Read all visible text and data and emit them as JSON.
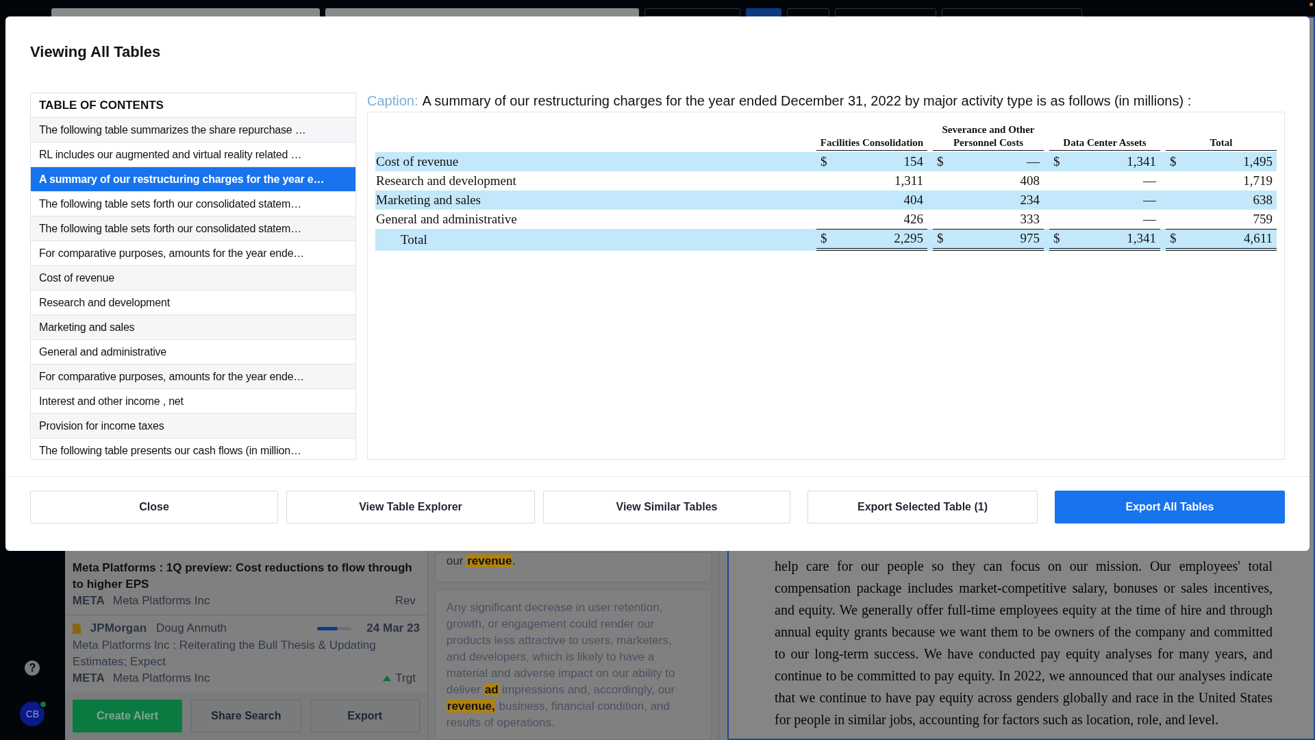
{
  "background": {
    "sidebar": {
      "help": "?",
      "avatar": {
        "initials": "CB",
        "online": true
      }
    },
    "news_items": [
      {
        "title": "Meta Platforms : 1Q preview: Cost reductions to flow through to higher EPS",
        "ticker": "META",
        "company": "Meta Platforms Inc",
        "tag": "Rev",
        "kind": "plain",
        "unread": true
      },
      {
        "source": "JPMorgan",
        "analyst": "Doug Anmuth",
        "level": 0.6,
        "date": "24 Mar 23",
        "title": "Meta Platforms Inc : Reiterating the Bull Thesis & Updating Estimates; Expect",
        "ticker": "META",
        "company": "Meta Platforms Inc",
        "tag": "Trgt",
        "kind": "up",
        "unread": false
      }
    ],
    "actions": [
      {
        "label": "Create Alert",
        "kind": "primary"
      },
      {
        "label": "Share Search",
        "kind": "secondary"
      },
      {
        "label": "Export",
        "kind": "secondary"
      }
    ],
    "snippets": [
      [
        {
          "text": "our ",
          "highlight": false
        },
        {
          "text": "revenue",
          "highlight": true
        },
        {
          "text": ".",
          "highlight": false
        }
      ],
      [
        {
          "text": "Any significant decrease in user retention, growth, or engagement could render our products less attractive to users, marketers, and developers, which is likely to have a material and adverse impact on our ability to deliver ",
          "highlight": false
        },
        {
          "text": "ad",
          "highlight": true
        },
        {
          "text": " impressions and, accordingly, our ",
          "highlight": false
        },
        {
          "text": "revenue,",
          "highlight": true
        },
        {
          "text": " business, financial condition, and results of operations.",
          "highlight": false
        }
      ]
    ],
    "document_text": "help care for our people so they can focus on our mission. Our employees' total compensation package includes market-competitive salary, bonuses or sales incentives, and equity. We generally offer full-time employees equity at the time of hire and through annual equity grants because we want them to be owners of the company and committed to our long-term success. We have conducted pay equity analyses for many years, and continue to be committed to pay equity. In 2022, we announced that our analyses indicate that we continue to have pay equity across genders globally and race in the United States for people in similar jobs, accounting for factors such as location, role, and level."
  },
  "modal": {
    "title": "Viewing All Tables",
    "toc": {
      "heading": "TABLE OF CONTENTS",
      "items": [
        {
          "label": "The following table summarizes the share repurchase …",
          "selected": false
        },
        {
          "label": "RL includes our augmented and virtual reality related …",
          "selected": false
        },
        {
          "label": "A summary of our restructuring charges for the year e…",
          "selected": true
        },
        {
          "label": "The following table sets forth our consolidated statem…",
          "selected": false
        },
        {
          "label": "The following table sets forth our consolidated statem…",
          "selected": false
        },
        {
          "label": "For comparative purposes, amounts for the year ende…",
          "selected": false
        },
        {
          "label": "Cost of revenue",
          "selected": false
        },
        {
          "label": "Research and development",
          "selected": false
        },
        {
          "label": "Marketing and sales",
          "selected": false
        },
        {
          "label": "General and administrative",
          "selected": false
        },
        {
          "label": "For comparative purposes, amounts for the year ende…",
          "selected": false
        },
        {
          "label": "Interest and other income , net",
          "selected": false
        },
        {
          "label": "Provision for income taxes",
          "selected": false
        },
        {
          "label": "The following table presents our cash flows (in million…",
          "selected": false
        }
      ]
    },
    "caption": {
      "label": "Caption:",
      "text": "A summary of our restructuring charges for the year ended December 31, 2022 by major activity type is as follows (in millions) :"
    },
    "table": {
      "columns": [
        "Facilities Consolidation",
        "Severance and Other Personnel Costs",
        "Data Center Assets",
        "Total"
      ],
      "rows": [
        {
          "label": "Cost of revenue",
          "kind": "line",
          "shaded": true,
          "cells": [
            {
              "currency": "$",
              "value": "154"
            },
            {
              "currency": "$",
              "value": "—"
            },
            {
              "currency": "$",
              "value": "1,341"
            },
            {
              "currency": "$",
              "value": "1,495"
            }
          ]
        },
        {
          "label": "Research and development",
          "kind": "line",
          "shaded": false,
          "cells": [
            {
              "value": "1,311"
            },
            {
              "value": "408"
            },
            {
              "value": "—"
            },
            {
              "value": "1,719"
            }
          ]
        },
        {
          "label": "Marketing and sales",
          "kind": "line",
          "shaded": true,
          "cells": [
            {
              "value": "404"
            },
            {
              "value": "234"
            },
            {
              "value": "—"
            },
            {
              "value": "638"
            }
          ]
        },
        {
          "label": "General and administrative",
          "kind": "line",
          "shaded": false,
          "cells": [
            {
              "value": "426"
            },
            {
              "value": "333"
            },
            {
              "value": "—"
            },
            {
              "value": "759"
            }
          ]
        },
        {
          "label": "Total",
          "kind": "total",
          "shaded": true,
          "cells": [
            {
              "currency": "$",
              "value": "2,295"
            },
            {
              "currency": "$",
              "value": "975"
            },
            {
              "currency": "$",
              "value": "1,341"
            },
            {
              "currency": "$",
              "value": "4,611"
            }
          ]
        }
      ]
    },
    "buttons": [
      {
        "label": "Close",
        "kind": "secondary"
      },
      {
        "label": "View Table Explorer",
        "kind": "secondary"
      },
      {
        "label": "View Similar Tables",
        "kind": "secondary"
      },
      {
        "label": "Export Selected Table (1)",
        "kind": "secondary"
      },
      {
        "label": "Export All Tables",
        "kind": "primary"
      }
    ]
  }
}
